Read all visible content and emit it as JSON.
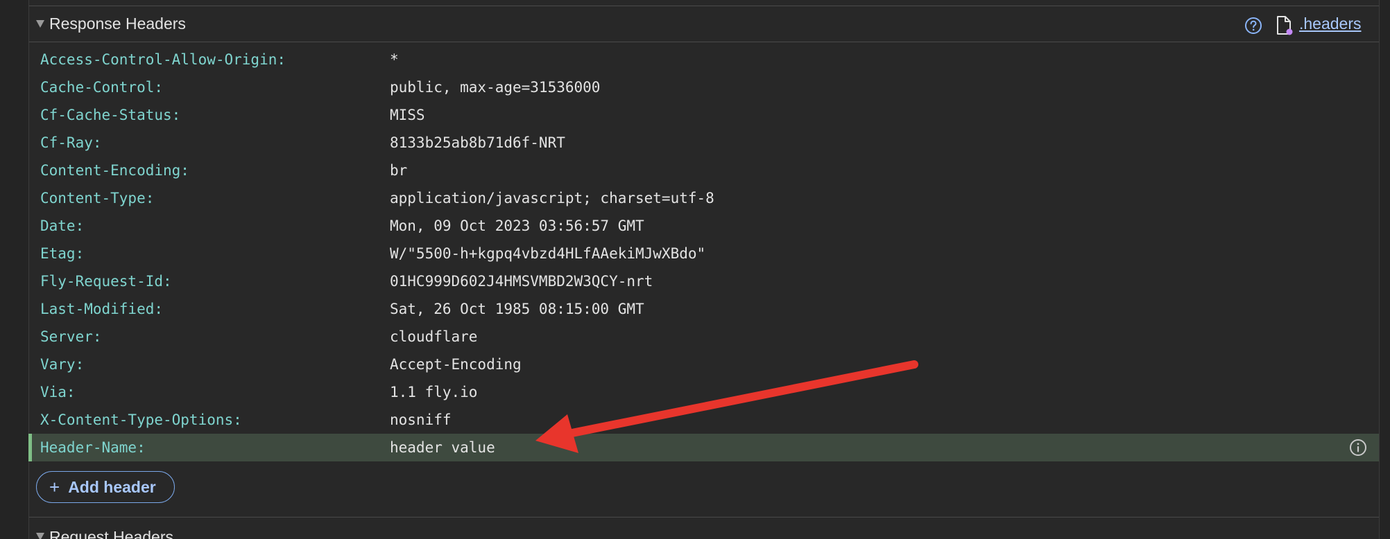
{
  "response_section": {
    "title": "Response Headers",
    "help_icon": "help-circle-icon",
    "file_icon": "file-override-icon",
    "headers_link": ".headers"
  },
  "headers": [
    {
      "name": "Access-Control-Allow-Origin:",
      "value": "*"
    },
    {
      "name": "Cache-Control:",
      "value": "public, max-age=31536000"
    },
    {
      "name": "Cf-Cache-Status:",
      "value": "MISS"
    },
    {
      "name": "Cf-Ray:",
      "value": "8133b25ab8b71d6f-NRT"
    },
    {
      "name": "Content-Encoding:",
      "value": "br"
    },
    {
      "name": "Content-Type:",
      "value": "application/javascript; charset=utf-8"
    },
    {
      "name": "Date:",
      "value": "Mon, 09 Oct 2023 03:56:57 GMT"
    },
    {
      "name": "Etag:",
      "value": "W/\"5500-h+kgpq4vbzd4HLfAAekiMJwXBdo\""
    },
    {
      "name": "Fly-Request-Id:",
      "value": "01HC999D602J4HMSVMBD2W3QCY-nrt"
    },
    {
      "name": "Last-Modified:",
      "value": "Sat, 26 Oct 1985 08:15:00 GMT"
    },
    {
      "name": "Server:",
      "value": "cloudflare"
    },
    {
      "name": "Vary:",
      "value": "Accept-Encoding"
    },
    {
      "name": "Via:",
      "value": "1.1 fly.io"
    },
    {
      "name": "X-Content-Type-Options:",
      "value": "nosniff"
    }
  ],
  "custom_header": {
    "name": "Header-Name:",
    "value": "header value",
    "info_icon": "info-icon"
  },
  "add_header": {
    "plus": "+",
    "label": "Add header"
  },
  "request_section": {
    "title": "Request Headers"
  },
  "colors": {
    "background": "#282828",
    "header_name": "#7fd5cf",
    "header_value": "#e3e3e3",
    "link": "#a8c7fa",
    "custom_row_bg": "#3e4a3f",
    "custom_row_accent": "#7fbf86",
    "annotation_arrow": "#e8352c"
  }
}
